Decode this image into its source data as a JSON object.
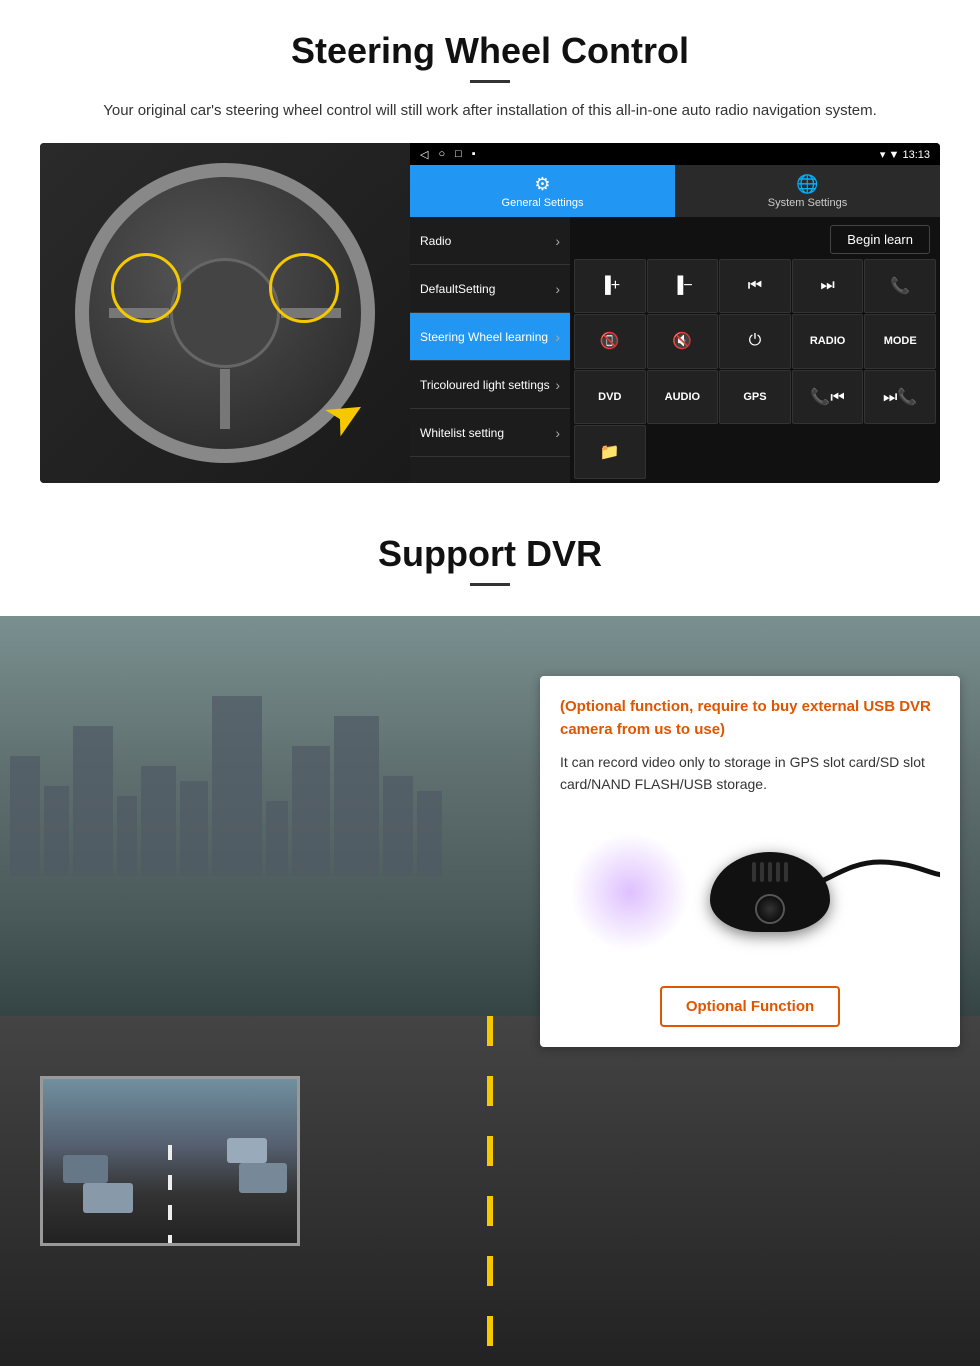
{
  "page": {
    "steering_section": {
      "title": "Steering Wheel Control",
      "description": "Your original car's steering wheel control will still work after installation of this all-in-one auto radio navigation system.",
      "android_ui": {
        "status_bar": {
          "icons_left": [
            "◁",
            "○",
            "□",
            "▪"
          ],
          "time": "13:13",
          "signal": "▾ ▼"
        },
        "tabs": [
          {
            "id": "general",
            "label": "General Settings",
            "icon": "⚙",
            "active": true
          },
          {
            "id": "system",
            "label": "System Settings",
            "icon": "🌐",
            "active": false
          }
        ],
        "menu_items": [
          {
            "label": "Radio",
            "active": false
          },
          {
            "label": "DefaultSetting",
            "active": false
          },
          {
            "label": "Steering Wheel learning",
            "active": true
          },
          {
            "label": "Tricoloured light settings",
            "active": false
          },
          {
            "label": "Whitelist setting",
            "active": false
          }
        ],
        "begin_learn_label": "Begin learn",
        "control_buttons": [
          {
            "id": "vol-up",
            "symbol": "▐+",
            "label": ""
          },
          {
            "id": "vol-down",
            "symbol": "▐−",
            "label": ""
          },
          {
            "id": "prev",
            "symbol": "⏮",
            "label": ""
          },
          {
            "id": "next",
            "symbol": "⏭",
            "label": ""
          },
          {
            "id": "phone",
            "symbol": "📞",
            "label": ""
          },
          {
            "id": "hang-up",
            "symbol": "📵",
            "label": ""
          },
          {
            "id": "mute",
            "symbol": "🔇",
            "label": ""
          },
          {
            "id": "power",
            "symbol": "⏻",
            "label": ""
          },
          {
            "id": "radio",
            "symbol": "",
            "label": "RADIO"
          },
          {
            "id": "mode",
            "symbol": "",
            "label": "MODE"
          },
          {
            "id": "dvd",
            "symbol": "",
            "label": "DVD"
          },
          {
            "id": "audio",
            "symbol": "",
            "label": "AUDIO"
          },
          {
            "id": "gps",
            "symbol": "",
            "label": "GPS"
          },
          {
            "id": "prev-track",
            "symbol": "📞⏮",
            "label": ""
          },
          {
            "id": "next-track",
            "symbol": "⏭📞",
            "label": ""
          },
          {
            "id": "folder",
            "symbol": "📁",
            "label": ""
          }
        ]
      }
    },
    "dvr_section": {
      "title": "Support DVR",
      "optional_text": "(Optional function, require to buy external USB DVR camera from us to use)",
      "description": "It can record video only to storage in GPS slot card/SD slot card/NAND FLASH/USB storage.",
      "optional_function_label": "Optional Function"
    }
  }
}
